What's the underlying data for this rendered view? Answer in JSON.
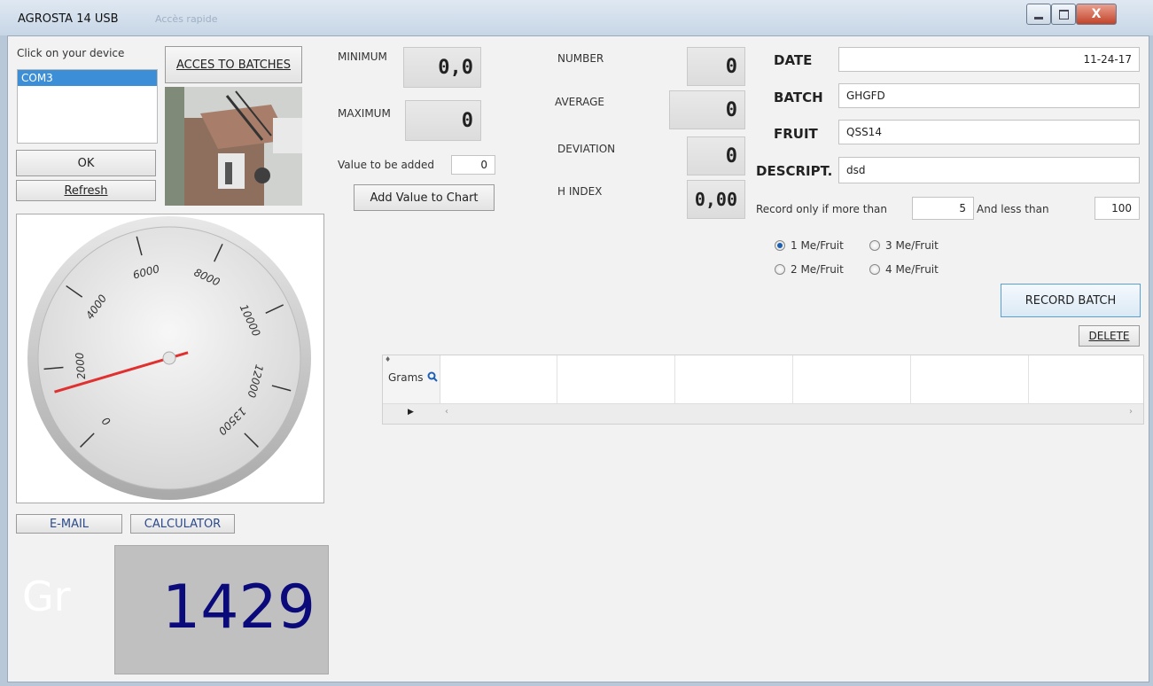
{
  "window": {
    "title": "AGROSTA 14 USB",
    "faded_title": "Accès rapide",
    "controls": {
      "minimize_icon": "minimize-icon",
      "maximize_icon": "maximize-icon",
      "close_glyph": "X"
    }
  },
  "device": {
    "prompt": "Click on your device",
    "ports": [
      "COM3"
    ],
    "selected_port": "COM3",
    "ok_label": "OK",
    "refresh_label": "Refresh",
    "batches_label": "ACCES TO BATCHES"
  },
  "stats": {
    "minimum_label": "MINIMUM",
    "minimum_value": "0,0",
    "maximum_label": "MAXIMUM",
    "maximum_value": "0",
    "value_to_add_label": "Value to be added",
    "value_to_add": "0",
    "add_chart_label": "Add Value to Chart",
    "number_label": "NUMBER",
    "number_value": "0",
    "average_label": "AVERAGE",
    "average_value": "0",
    "deviation_label": "DEVIATION",
    "deviation_value": "0",
    "hindex_label": "H INDEX",
    "hindex_value": "0,00"
  },
  "record": {
    "date_label": "DATE",
    "date_value": "11-24-17",
    "batch_label": "BATCH",
    "batch_value": "GHGFD",
    "fruit_label": "FRUIT",
    "fruit_value": "QSS14",
    "descript_label": "DESCRIPT.",
    "descript_value": "dsd",
    "more_than_label": "Record only if more than",
    "more_than_value": "5",
    "less_than_label": "And less than",
    "less_than_value": "100",
    "options": [
      {
        "label": "1 Me/Fruit",
        "selected": true
      },
      {
        "label": "3 Me/Fruit",
        "selected": false
      },
      {
        "label": "2 Me/Fruit",
        "selected": false
      },
      {
        "label": "4 Me/Fruit",
        "selected": false
      }
    ],
    "record_label": "RECORD BATCH",
    "delete_label": "DELETE"
  },
  "grid": {
    "header": "Grams",
    "search_icon": "magnifier-icon"
  },
  "gauge": {
    "ticks": [
      "0",
      "2000",
      "4000",
      "6000",
      "8000",
      "10000",
      "12000",
      "13500"
    ],
    "min": 0,
    "max": 13500,
    "value": 1429,
    "needle_color": "#e03030"
  },
  "footer": {
    "email_label": "E-MAIL",
    "calculator_label": "CALCULATOR",
    "unit": "Gr",
    "weight": "1429",
    "weight_color": "#0a0a7a"
  }
}
